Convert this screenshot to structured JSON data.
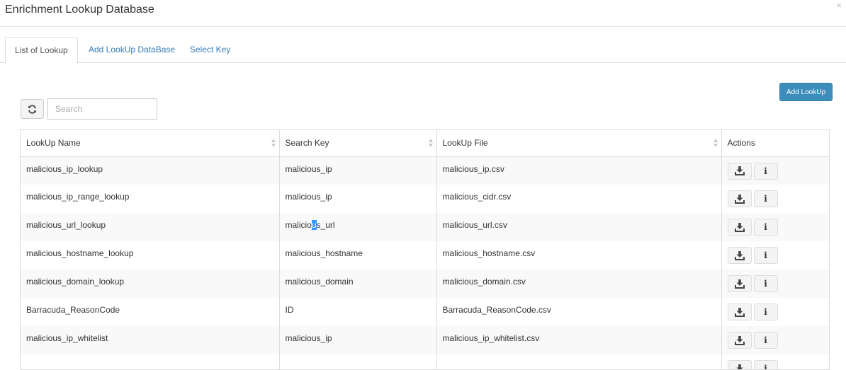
{
  "modal": {
    "title": "Enrichment Lookup Database",
    "close_glyph": "×"
  },
  "tabs": [
    {
      "label": "List of Lookup",
      "active": true
    },
    {
      "label": "Add LookUp DataBase",
      "active": false
    },
    {
      "label": "Select Key",
      "active": false
    }
  ],
  "toolbar": {
    "add_lookup_label": "Add LookUp",
    "refresh_icon": "refresh-icon",
    "search_placeholder": "Search",
    "search_value": ""
  },
  "table": {
    "columns": [
      "LookUp Name",
      "Search Key",
      "LookUp File",
      "Actions"
    ],
    "rows": [
      {
        "name": "malicious_ip_lookup",
        "key": "malicious_ip",
        "file": "malicious_ip.csv"
      },
      {
        "name": "malicious_ip_range_lookup",
        "key": "malicious_ip",
        "file": "malicious_cidr.csv"
      },
      {
        "name": "malicious_url_lookup",
        "key": "malicious_url",
        "file": "malicious_url.csv"
      },
      {
        "name": "malicious_hostname_lookup",
        "key": "malicious_hostname",
        "file": "malicious_hostname.csv"
      },
      {
        "name": "malicious_domain_lookup",
        "key": "malicious_domain",
        "file": "malicious_domain.csv"
      },
      {
        "name": "Barracuda_ReasonCode",
        "key": "ID",
        "file": "Barracuda_ReasonCode.csv"
      },
      {
        "name": "malicious_ip_whitelist",
        "key": "malicious_ip",
        "file": "malicious_ip_whitelist.csv"
      },
      {
        "name": "",
        "key": "",
        "file": ""
      }
    ],
    "action_icons": [
      "download-icon",
      "info-icon"
    ],
    "info_glyph": "i"
  },
  "colors": {
    "primary_button": "#3c8dbc",
    "link": "#337ab7",
    "selection": "#3399ff"
  }
}
